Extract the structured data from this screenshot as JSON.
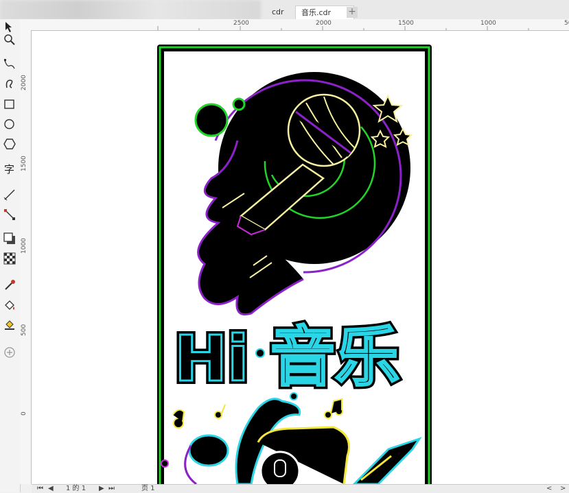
{
  "tabs": [
    {
      "label": "cdr"
    },
    {
      "label": "音乐.cdr"
    }
  ],
  "ruler_h": [
    "2500",
    "2000",
    "1500",
    "1000",
    "50"
  ],
  "ruler_v": [
    "2000",
    "1500",
    "1000",
    "500",
    "0"
  ],
  "artwork": {
    "title_latin": "Hi",
    "title_cn": "音乐"
  },
  "status": {
    "page_count": "1 的 1",
    "page_tab": "页 1"
  },
  "colors": {
    "neon_purple": "#8a22c8",
    "neon_green": "#22d42a",
    "neon_yellow": "#f6f0a0",
    "neon_cyan": "#2ad6e6",
    "border_green": "#1ea81e"
  },
  "tools": [
    "zoom-icon",
    "freehand-icon",
    "artistic-media-icon",
    "rectangle-icon",
    "ellipse-icon",
    "polygon-icon",
    "text-icon",
    "dimension-icon",
    "connector-icon",
    "shadow-icon",
    "transparency-icon",
    "eyedropper-icon",
    "fill-icon",
    "smart-fill-icon",
    "add-tool-icon"
  ]
}
